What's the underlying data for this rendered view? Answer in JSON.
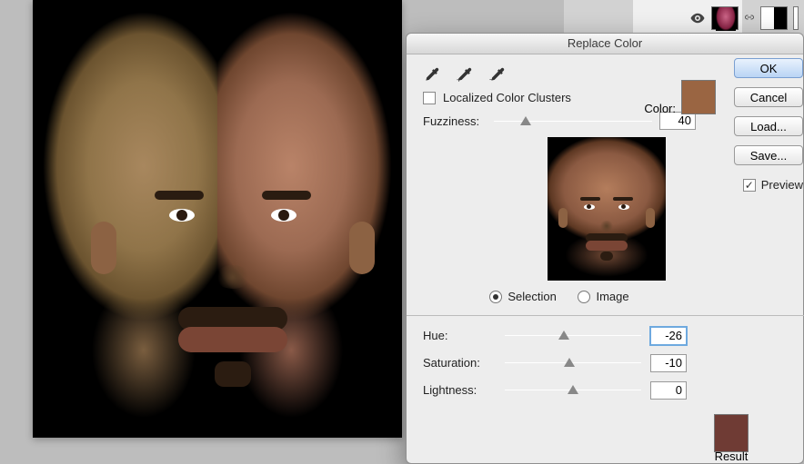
{
  "dialog": {
    "title": "Replace Color",
    "eyedroppers": [
      "eyedropper",
      "eyedropper-add",
      "eyedropper-subtract"
    ],
    "localized_label": "Localized Color Clusters",
    "localized_checked": false,
    "color_label": "Color:",
    "color_swatch": "#9a6542",
    "fuzziness_label": "Fuzziness:",
    "fuzziness_value": "40",
    "fuzziness_pos_pct": 20,
    "view_mode": {
      "options": [
        "Selection",
        "Image"
      ],
      "selected": "Selection"
    },
    "adjust": {
      "hue_label": "Hue:",
      "hue_value": "-26",
      "hue_pos_pct": 43,
      "sat_label": "Saturation:",
      "sat_value": "-10",
      "sat_pos_pct": 47,
      "light_label": "Lightness:",
      "light_value": "0",
      "light_pos_pct": 50
    },
    "result_label": "Result",
    "result_swatch": "#6f3b34",
    "buttons": {
      "ok": "OK",
      "cancel": "Cancel",
      "load": "Load...",
      "save": "Save..."
    },
    "preview_label": "Preview",
    "preview_checked": true
  },
  "layers_panel": {
    "visibility_icon": "eye-icon",
    "link_icon": "link-icon"
  }
}
